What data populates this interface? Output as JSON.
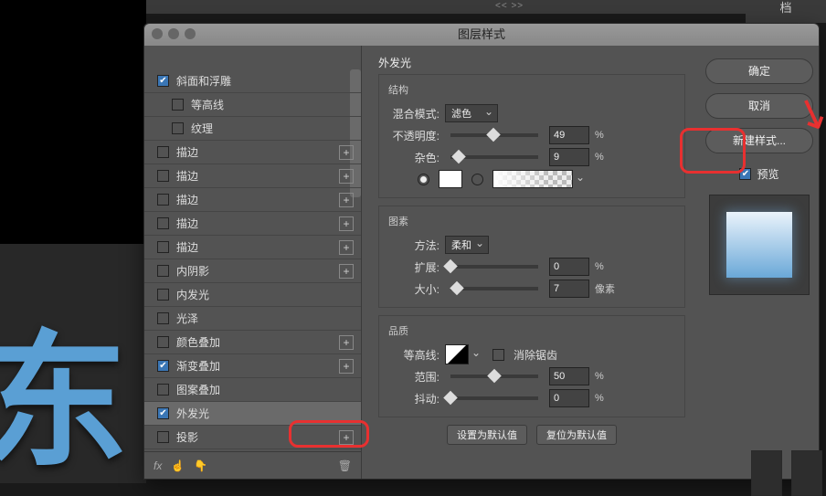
{
  "top_tag": "档",
  "top_arrows": "<<   >>",
  "dialog": {
    "title": "图层样式"
  },
  "fx": {
    "items": [
      {
        "label": "斜面和浮雕",
        "checked": true,
        "plus": false,
        "sub": false
      },
      {
        "label": "等高线",
        "checked": false,
        "plus": false,
        "sub": true
      },
      {
        "label": "纹理",
        "checked": false,
        "plus": false,
        "sub": true
      },
      {
        "label": "描边",
        "checked": false,
        "plus": true,
        "sub": false
      },
      {
        "label": "描边",
        "checked": false,
        "plus": true,
        "sub": false
      },
      {
        "label": "描边",
        "checked": false,
        "plus": true,
        "sub": false
      },
      {
        "label": "描边",
        "checked": false,
        "plus": true,
        "sub": false
      },
      {
        "label": "描边",
        "checked": false,
        "plus": true,
        "sub": false
      },
      {
        "label": "内阴影",
        "checked": false,
        "plus": true,
        "sub": false
      },
      {
        "label": "内发光",
        "checked": false,
        "plus": false,
        "sub": false
      },
      {
        "label": "光泽",
        "checked": false,
        "plus": false,
        "sub": false
      },
      {
        "label": "颜色叠加",
        "checked": false,
        "plus": true,
        "sub": false
      },
      {
        "label": "渐变叠加",
        "checked": true,
        "plus": true,
        "sub": false
      },
      {
        "label": "图案叠加",
        "checked": false,
        "plus": false,
        "sub": false
      },
      {
        "label": "外发光",
        "checked": true,
        "plus": false,
        "sub": false,
        "selected": true
      },
      {
        "label": "投影",
        "checked": false,
        "plus": true,
        "sub": false
      }
    ],
    "footer_fx": "fx"
  },
  "settings": {
    "panel_title": "外发光",
    "structure": {
      "title": "结构",
      "blend_label": "混合模式:",
      "blend_value": "滤色",
      "opacity_label": "不透明度:",
      "opacity_value": "49",
      "opacity_unit": "%",
      "noise_label": "杂色:",
      "noise_value": "9",
      "noise_unit": "%"
    },
    "elements": {
      "title": "图素",
      "technique_label": "方法:",
      "technique_value": "柔和",
      "spread_label": "扩展:",
      "spread_value": "0",
      "spread_unit": "%",
      "size_label": "大小:",
      "size_value": "7",
      "size_unit": "像素"
    },
    "quality": {
      "title": "品质",
      "contour_label": "等高线:",
      "antialias_label": "消除锯齿",
      "range_label": "范围:",
      "range_value": "50",
      "range_unit": "%",
      "jitter_label": "抖动:",
      "jitter_value": "0",
      "jitter_unit": "%"
    },
    "set_default": "设置为默认值",
    "reset_default": "复位为默认值"
  },
  "right": {
    "ok": "确定",
    "cancel": "取消",
    "new_style": "新建样式...",
    "preview": "预览"
  },
  "bg_glyph": "东"
}
